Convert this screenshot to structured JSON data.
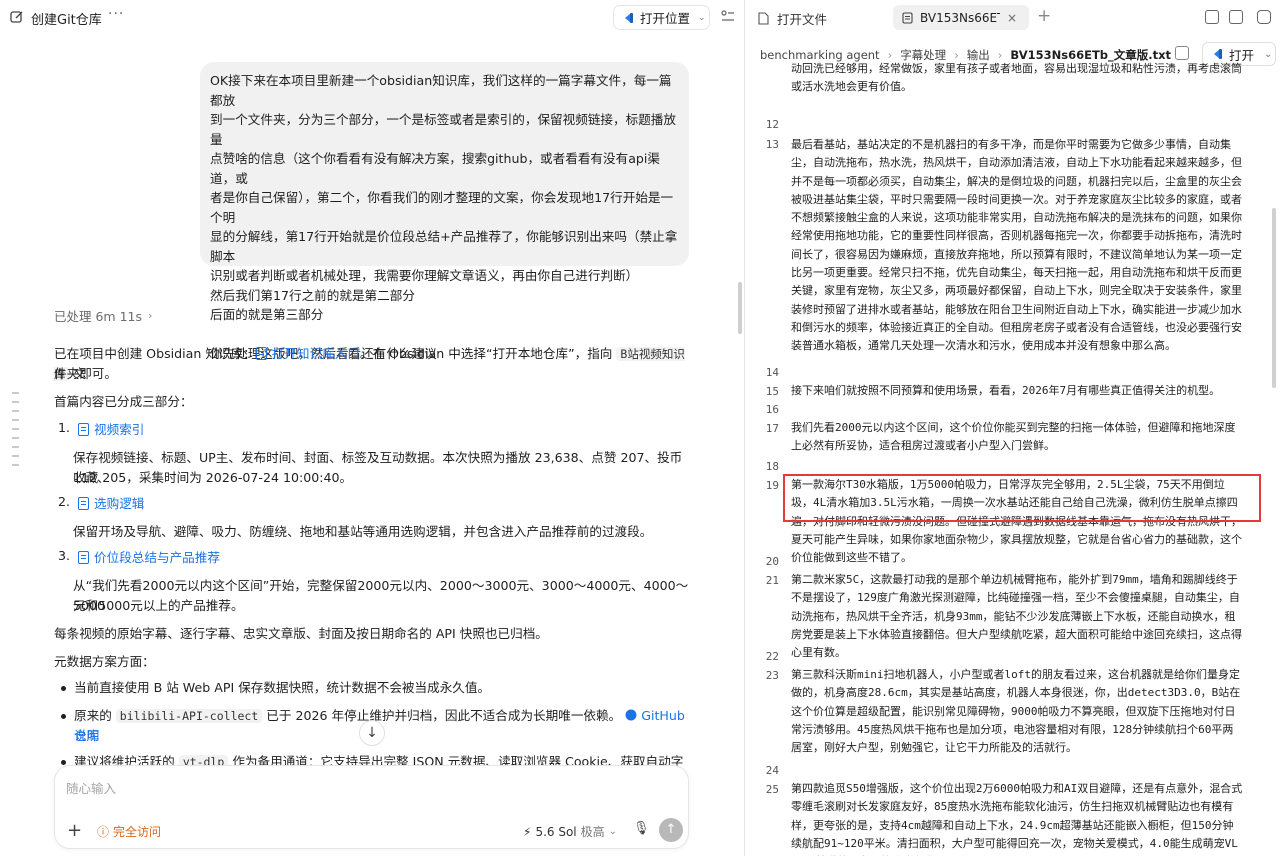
{
  "left": {
    "title": "创建Git仓库",
    "more": "···",
    "open_location": "打开位置",
    "user_message": [
      "OK接下来在本项目里新建一个obsidian知识库，我们这样的一篇字幕文件，每一篇都放",
      "到一个文件夹，分为三个部分，一个是标签或者是索引的，保留视频链接，标题播放量",
      "点赞啥的信息（这个你看看有没有解决方案，搜索github，或者看看有没有api渠道，或",
      "者是你自己保留），第二个，你看我们的刚才整理的文案，你会发现地17行开始是一个明",
      "显的分解线，第17行开始就是价位段总结+产品推荐了，你能够识别出来吗（禁止拿脚本",
      "识别或者判断或者机械处理，我需要你理解文章语义，再由你自己进行判断）",
      "然后我们第17行之前的就是第二部分",
      "后面的就是第三部分",
      "",
      "你先处理这版吧，然后看看还有什么建议"
    ],
    "processed": "已处理 6m 11s",
    "resp_intro_a": "已在项目中创建 Obsidian 知识库：",
    "resp_intro_link": "打开知识库入口",
    "resp_intro_b": "。在 Obsidian 中选择“打开本地仓库”，指向",
    "resp_intro_code": "B站视频知识库",
    "resp_intro_c": "文",
    "resp_intro_d": "件夹即可。",
    "resp_sections": "首篇内容已分成三部分：",
    "items": [
      {
        "num": "1.",
        "title": "视频索引",
        "desc": [
          "保存视频链接、标题、UP主、发布时间、封面、标签及互动数据。本次快照为播放 23,638、点赞 207、投币 112、",
          "收藏 205，采集时间为 2026-07-24 10:00:40。"
        ]
      },
      {
        "num": "2.",
        "title": "选购逻辑",
        "desc": [
          "保留开场及导航、避障、吸力、防缠绕、拖地和基站等通用选购逻辑，并包含进入产品推荐前的过渡段。"
        ]
      },
      {
        "num": "3.",
        "title": "价位段总结与产品推荐",
        "desc": [
          "从“我们先看2000元以内这个区间”开始，完整保留2000元以内、2000～3000元、3000～4000元、4000～5000",
          "元和5000元以上的产品推荐。"
        ]
      }
    ],
    "archive_line": "每条视频的原始字幕、逐行字幕、忠实文章版、封面及按日期命名的 API 快照也已归档。",
    "meta_heading": "元数据方案方面：",
    "bullet1": "当前直接使用 B 站 Web API 保存数据快照，统计数据不会被当成永久值。",
    "bullet2_a": "原来的",
    "bullet2_code": "bilibili-API-collect",
    "bullet2_b": "已于 2026 年停止维护并归档，因此不适合成为长期唯一依赖。",
    "bullet2_link1": "GitHub 仓库",
    "bullet2_link2": "说明",
    "bullet3_a": "建议将维护活跃的",
    "bullet3_code": "yt-dlp",
    "bullet3_b": "作为备用通道：它支持导出完整 JSON 元数据、读取浏览器 Cookie、获取自动字幕，",
    "input_placeholder": "随心输入",
    "access_label": "完全访问",
    "model_label": "5.6 Sol",
    "model_level": "极高",
    "colors": {
      "accent": "#1a73e8",
      "warning": "#d9661b",
      "highlight_box": "#e43a3a"
    }
  },
  "right": {
    "tab_open_files": "打开文件",
    "tab_file": "BV153Ns66ETb_文章版.txt",
    "tab_close": "×",
    "tab_add": "+",
    "breadcrumb": [
      "benchmarking agent",
      "字幕处理",
      "输出",
      "BV153Ns66ETb_文章版.txt"
    ],
    "open_label": "打开",
    "lines": [
      {
        "n": "",
        "t": "动回洗已经够用，经常做饭，家里有孩子或者地面，容易出现湿垃圾和粘性污渍，再考虑滚筒或活水洗地会更有价值。"
      },
      {
        "n": "12",
        "t": ""
      },
      {
        "n": "13",
        "t": "最后看基站，基站决定的不是机器扫的有多干净，而是你平时需要为它做多少事情，自动集尘，自动洗拖布，热水洗，热风烘干，自动添加清洁液，自动上下水功能看起来越来越多，但并不是每一项都必须买，自动集尘，解决的是倒垃圾的问题，机器扫完以后，尘盒里的灰尘会被吸进基站集尘袋，平时只需要隔一段时间更换一次。对于养宠家庭灰尘比较多的家庭，或者不想频繁接触尘盒的人来说，这项功能非常实用，自动洗拖布解决的是洗抹布的问题，如果你经常使用拖地功能，它的重要性同样很高，否则机器每拖完一次，你都要手动拆拖布，清洗时间长了，很容易因为嫌麻烦，直接放弃拖地，所以预算有限时，不建议简单地认为某一项一定比另一项更重要。经常只扫不拖，优先自动集尘，每天扫拖一起，用自动洗拖布和烘干反而更关键，家里有宠物，灰尘又多，两项最好都保留，自动上下水，则完全取决于安装条件，家里装修时预留了进排水或者基站，能够放在阳台卫生间附近自动上下水，确实能进一步减少加水和倒污水的频率，体验接近真正的全自动。但租房老房子或者没有合适管线，也没必要强行安装普通水箱板，通常几天处理一次清水和污水，使用成本并没有想象中那么高。"
      },
      {
        "n": "14",
        "t": ""
      },
      {
        "n": "15",
        "t": "接下来咱们就按照不同预算和使用场景，看看，2026年7月有哪些真正值得关注的机型。"
      },
      {
        "n": "16",
        "t": ""
      },
      {
        "n": "17",
        "t": "我们先看2000元以内这个区间，这个价位你能买到完整的扫拖一体体验，但避障和拖地深度上必然有所妥协，适合租房过渡或者小户型入门尝鲜。"
      },
      {
        "n": "18",
        "t": ""
      },
      {
        "n": "19",
        "t": "第一款海尔T30水箱版，1万5000帕吸力，日常浮灰完全够用，2.5L尘袋，75天不用倒垃圾，4L清水箱加3.5L污水箱，一周换一次水基站还能自己给自己洗澡，微利仿生脱单点擦四遍，对付脚印和轻微污渍没问题。但碰撞式避障遇到数据线基本靠运气，拖布没有热风烘干，夏天可能产生异味，如果你家地面杂物少，家具摆放规整，它就是台省心省力的基础款，这个价位能做到这些不错了。"
      },
      {
        "n": "20",
        "t": ""
      },
      {
        "n": "21",
        "t": "第二款米家5C，这款最打动我的是那个单边机械臂拖布，能外扩到79mm，墙角和踢脚线终于不是摆设了，129度广角激光探测避障，比纯碰撞强一档，至少不会傻撞桌腿，自动集尘，自动洗拖布，热风烘干全齐活，机身93mm，能钻不少沙发底薄嵌上下水板，还能自动换水，租房党要是装上下水体验直接翻倍。但大户型续航吃紧，超大面积可能给中途回充续扫，这点得心里有数。"
      },
      {
        "n": "22",
        "t": ""
      },
      {
        "n": "23",
        "t": "第三款科沃斯mini扫地机器人，小户型或者loft的朋友看过来，这台机器就是给你们量身定做的，机身高度28.6cm，其实是基站高度，机器人本身很迷，你，出detect3D3.0，B站在这个价位算是超级配置，能识别常见障碍物，9000帕吸力不算亮眼，但双旋下压拖地对付日常污渍够用。45度热风烘干拖布也是加分项，电池容量相对有限，128分钟续航扫个60平两居室，刚好大户型，别勉强它，让它干力所能及的活就行。"
      },
      {
        "n": "24",
        "t": ""
      },
      {
        "n": "25",
        "t": "第四款追觅S50增强版，这个价位出现2万6000帕吸力和AI双目避障，还是有点意外，混合式零缠毛滚刷对长发家庭友好，85度热水洗拖布能软化油污，仿生扫拖双机械臂贴边也有模有样，更夸张的是，支持4cm越障和自动上下水，24.9cm超薄基站还能嵌入橱柜，但150分钟续航配91~120平米。清扫面积，大户型可能得回充一次，宠物关爱模式，4.0能生成萌宠VLOG，养猫的朋友可能会觉得有"
      }
    ]
  }
}
